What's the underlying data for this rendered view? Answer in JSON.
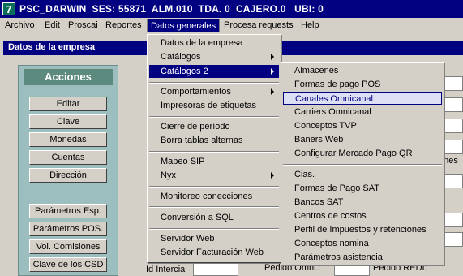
{
  "titlebar": {
    "icon": "7",
    "text": "PSC_DARWIN  SES: 55871  ALM.010  TDA. 0  CAJERO.0   UBI: 0"
  },
  "menubar": {
    "items": [
      "Archivo",
      "Edit",
      "Proscai",
      "Reportes",
      "Datos generales",
      "Procesa requests",
      "Help"
    ]
  },
  "window": {
    "title": "Datos de la empresa"
  },
  "acciones": {
    "header": "Acciones",
    "buttons": [
      "Editar",
      "Clave",
      "Monedas",
      "Cuentas",
      "Dirección"
    ],
    "buttons2": [
      "Parámetros Esp.",
      "Parámetros POS.",
      "Vol. Comisiones",
      "Clave de los CSD"
    ]
  },
  "fields": {
    "id_intercia": "Id Intercia",
    "pedido_omni": "Pedido Omni.:",
    "pedido_redi": "Pedido REDI:",
    "partial_ones": "ones"
  },
  "menu_datos": {
    "items": [
      "Datos de la empresa",
      "Catálogos",
      "Catálogos 2",
      "Comportamientos",
      "Impresoras de etiquetas",
      "Cierre de período",
      "Borra tablas alternas",
      "Mapeo SIP",
      "Nyx",
      "Monitoreo conecciones",
      "Conversión a SQL",
      "Servidor Web",
      "Servidor Facturación Web"
    ]
  },
  "menu_catalogos2": {
    "items": [
      "Almacenes",
      "Formas de pago POS",
      "Canales Omnicanal",
      "Carriers Omnicanal",
      "Conceptos TVP",
      "Baners Web",
      "Configurar Mercado Pago QR",
      "Cias.",
      "Formas de Pago SAT",
      "Bancos SAT",
      "Centros de costos",
      "Perfil de Impuestos y retenciones",
      "Conceptos nomina",
      "Parámetros asistencia"
    ]
  },
  "colors": {
    "titlebar": "#000080",
    "highlight": "#000080",
    "panel": "#9cbebe",
    "panel_header": "#5d8a7e"
  }
}
